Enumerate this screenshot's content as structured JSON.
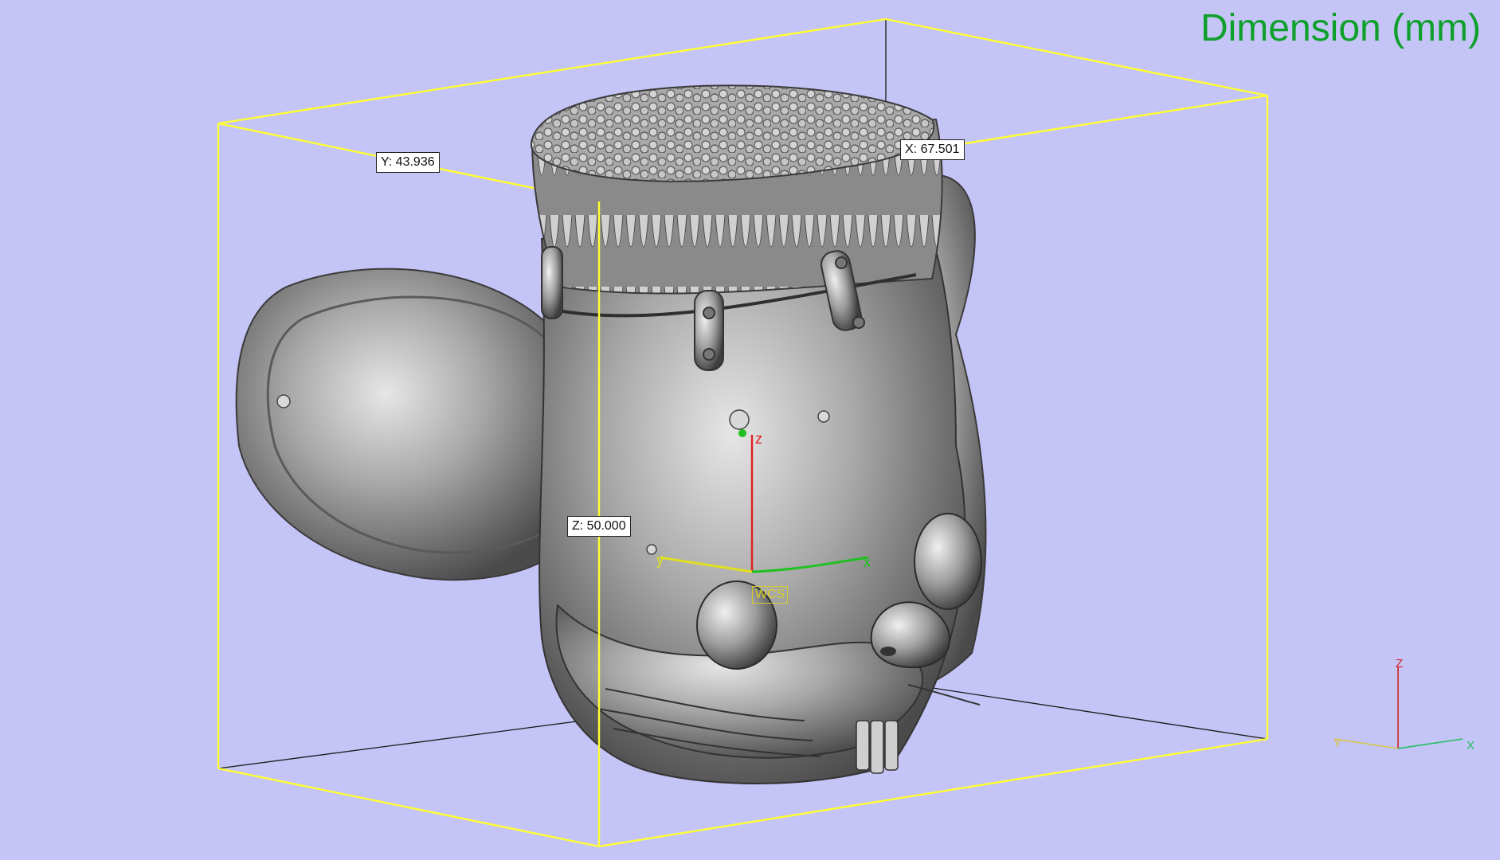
{
  "viewport": {
    "title": "Dimension (mm)",
    "background": "#c4c4f6",
    "bounding_box_color": "#ffff33",
    "title_color": "#0fa02c"
  },
  "dimensions": {
    "x_label": "X: 67.501",
    "y_label": "Y: 43.936",
    "z_label": "Z: 50.000"
  },
  "wcs": {
    "tag": "WCS",
    "x_axis": "x",
    "y_axis": "y",
    "z_axis": "z",
    "x_color": "#20c020",
    "y_color": "#e0e020",
    "z_color": "#e02020"
  },
  "triad": {
    "x_axis": "X",
    "y_axis": "Y",
    "z_axis": "Z",
    "x_color": "#20c060",
    "y_color": "#d8c840",
    "z_color": "#d02020"
  },
  "model": {
    "name": "3d-mesh-model",
    "color": "#9a9a9a"
  }
}
